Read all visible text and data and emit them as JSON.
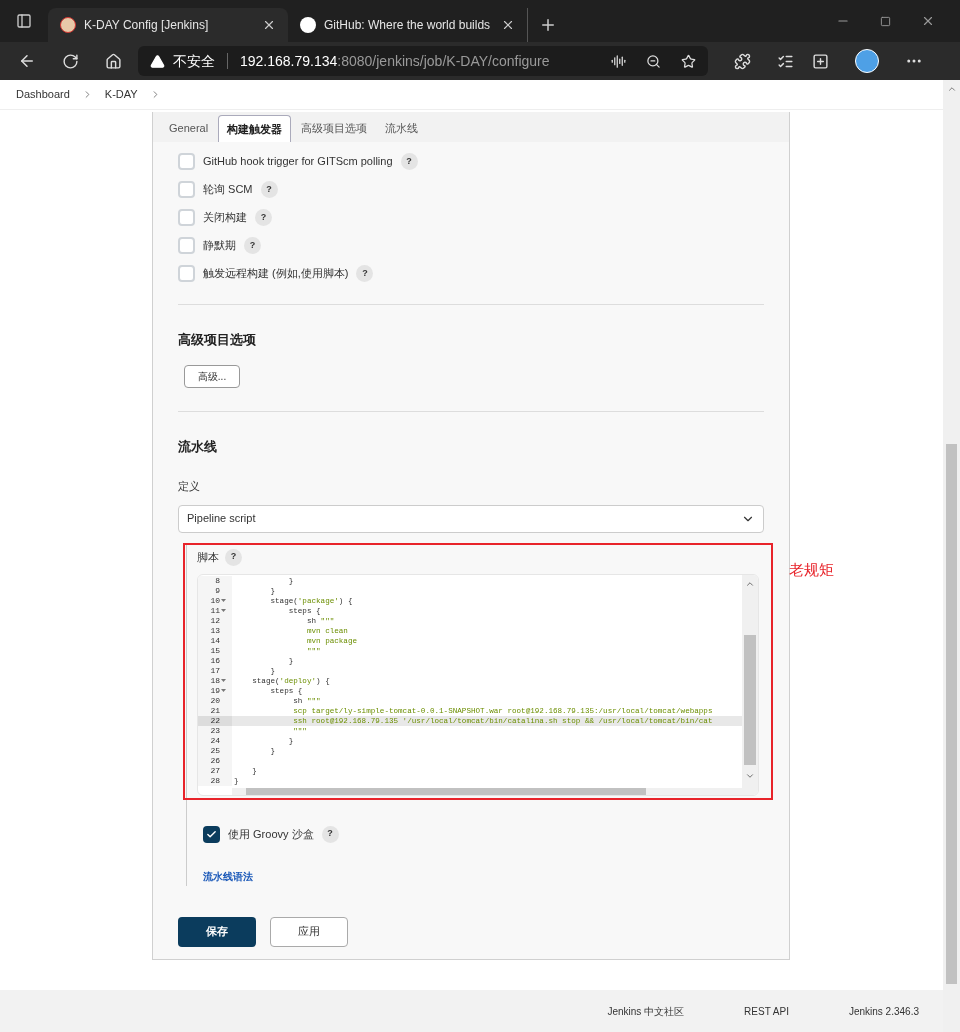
{
  "browser": {
    "tabs": [
      {
        "title": "K-DAY Config [Jenkins]",
        "selected": true
      },
      {
        "title": "GitHub: Where the world builds",
        "selected": false
      }
    ],
    "security": "不安全",
    "url_host": "192.168.79.134",
    "url_rest": ":8080/jenkins/job/K-DAY/configure"
  },
  "breadcrumbs": [
    "Dashboard",
    "K-DAY"
  ],
  "form_tabs": [
    {
      "label": "General",
      "selected": false
    },
    {
      "label": "构建触发器",
      "selected": true
    },
    {
      "label": "高级项目选项",
      "selected": false
    },
    {
      "label": "流水线",
      "selected": false
    }
  ],
  "triggers": [
    {
      "label": "GitHub hook trigger for GITScm polling",
      "checked": false,
      "help": "?"
    },
    {
      "label": "轮询 SCM",
      "checked": false,
      "help": "?"
    },
    {
      "label": "关闭构建",
      "checked": false,
      "help": "?"
    },
    {
      "label": "静默期",
      "checked": false,
      "help": "?"
    },
    {
      "label": "触发远程构建 (例如,使用脚本)",
      "checked": false,
      "help": "?"
    }
  ],
  "advanced": {
    "heading": "高级项目选项",
    "button": "高级..."
  },
  "pipeline": {
    "heading": "流水线",
    "definition_label": "定义",
    "definition_value": "Pipeline script",
    "script_label": "脚本",
    "script_help": "?",
    "code": [
      {
        "no": "8",
        "fold": false,
        "active": false,
        "parts": [
          {
            "text": "            }",
            "kind": "plain"
          }
        ]
      },
      {
        "no": "9",
        "fold": false,
        "active": false,
        "parts": [
          {
            "text": "        }",
            "kind": "plain"
          }
        ]
      },
      {
        "no": "10",
        "fold": true,
        "active": false,
        "parts": [
          {
            "text": "        stage(",
            "kind": "plain"
          },
          {
            "text": "'package'",
            "kind": "string"
          },
          {
            "text": ") {",
            "kind": "plain"
          }
        ]
      },
      {
        "no": "11",
        "fold": true,
        "active": false,
        "parts": [
          {
            "text": "            steps {",
            "kind": "plain"
          }
        ]
      },
      {
        "no": "12",
        "fold": false,
        "active": false,
        "parts": [
          {
            "text": "                sh ",
            "kind": "plain"
          },
          {
            "text": "\"\"\"",
            "kind": "string"
          }
        ]
      },
      {
        "no": "13",
        "fold": false,
        "active": false,
        "parts": [
          {
            "text": "                mvn clean",
            "kind": "string"
          }
        ]
      },
      {
        "no": "14",
        "fold": false,
        "active": false,
        "parts": [
          {
            "text": "                mvn package",
            "kind": "string"
          }
        ]
      },
      {
        "no": "15",
        "fold": false,
        "active": false,
        "parts": [
          {
            "text": "                \"\"\"",
            "kind": "string"
          }
        ]
      },
      {
        "no": "16",
        "fold": false,
        "active": false,
        "parts": [
          {
            "text": "            }",
            "kind": "plain"
          }
        ]
      },
      {
        "no": "17",
        "fold": false,
        "active": false,
        "parts": [
          {
            "text": "        }",
            "kind": "plain"
          }
        ]
      },
      {
        "no": "18",
        "fold": true,
        "active": false,
        "parts": [
          {
            "text": "    stage(",
            "kind": "plain"
          },
          {
            "text": "'deploy'",
            "kind": "string"
          },
          {
            "text": ") {",
            "kind": "plain"
          }
        ]
      },
      {
        "no": "19",
        "fold": true,
        "active": false,
        "parts": [
          {
            "text": "        steps {",
            "kind": "plain"
          }
        ]
      },
      {
        "no": "20",
        "fold": false,
        "active": false,
        "parts": [
          {
            "text": "             sh ",
            "kind": "plain"
          },
          {
            "text": "\"\"\"",
            "kind": "string"
          }
        ]
      },
      {
        "no": "21",
        "fold": false,
        "active": false,
        "parts": [
          {
            "text": "             scp target/ly-simple-tomcat-0.0.1-SNAPSHOT.war root@192.168.79.135:/usr/local/tomcat/webapps",
            "kind": "string"
          }
        ]
      },
      {
        "no": "22",
        "fold": false,
        "active": true,
        "parts": [
          {
            "text": "             ssh root@192.168.79.135 '/usr/local/tomcat/bin/catalina.sh stop && /usr/local/tomcat/bin/cat",
            "kind": "string"
          }
        ]
      },
      {
        "no": "23",
        "fold": false,
        "active": false,
        "parts": [
          {
            "text": "             \"\"\"",
            "kind": "string"
          }
        ]
      },
      {
        "no": "24",
        "fold": false,
        "active": false,
        "parts": [
          {
            "text": "            }",
            "kind": "plain"
          }
        ]
      },
      {
        "no": "25",
        "fold": false,
        "active": false,
        "parts": [
          {
            "text": "        }",
            "kind": "plain"
          }
        ]
      },
      {
        "no": "26",
        "fold": false,
        "active": false
      },
      {
        "no": "27",
        "fold": false,
        "active": false,
        "parts": [
          {
            "text": "    }",
            "kind": "plain"
          }
        ]
      },
      {
        "no": "28",
        "fold": false,
        "active": false,
        "parts": [
          {
            "text": "}",
            "kind": "plain"
          }
        ]
      }
    ],
    "sandbox": {
      "label": "使用 Groovy 沙盒",
      "checked": true,
      "help": "?"
    },
    "syntax_link": "流水线语法"
  },
  "annotation": "老规矩",
  "actions": [
    {
      "label": "保存",
      "kind": "primary"
    },
    {
      "label": "应用",
      "kind": "secondary"
    }
  ],
  "footer": [
    "Jenkins 中文社区",
    "REST API",
    "Jenkins 2.346.3"
  ]
}
